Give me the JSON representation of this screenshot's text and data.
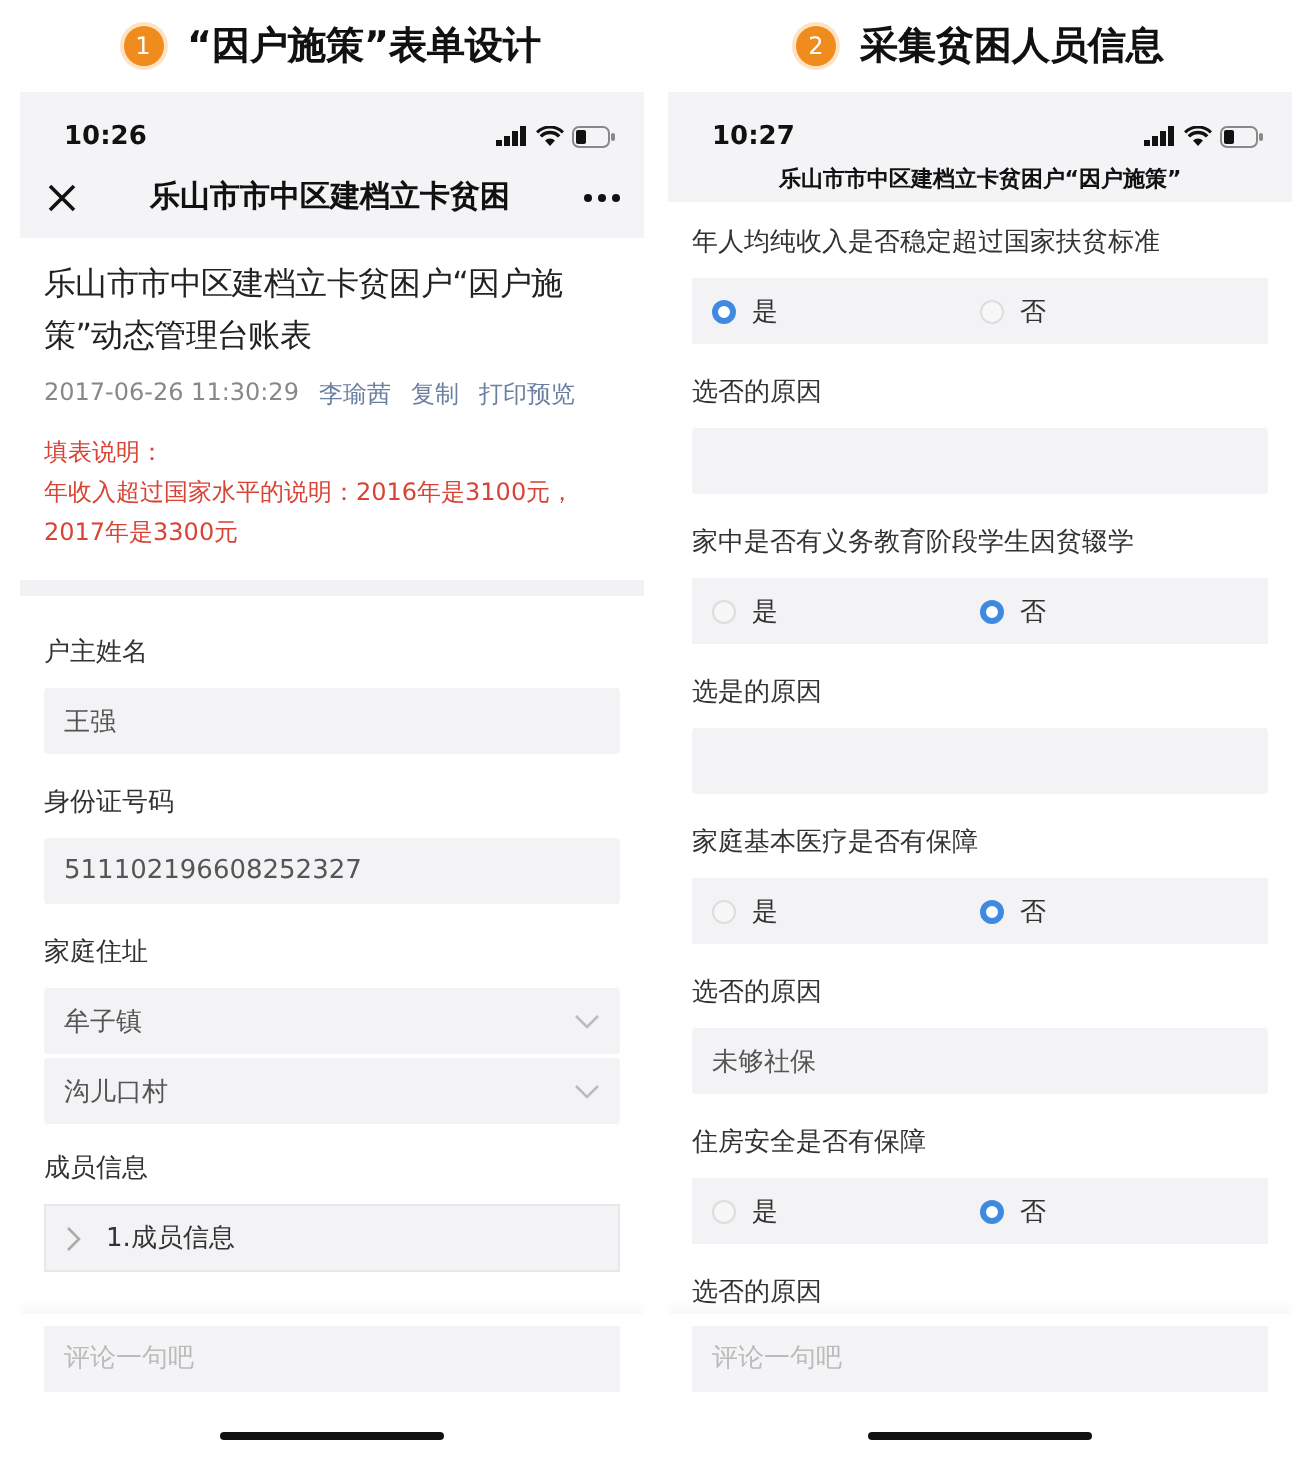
{
  "panels": [
    {
      "badge": "1",
      "title": "“因户施策”表单设计",
      "phone": {
        "time": "10:26",
        "nav": {
          "kind": "full",
          "title": "乐山市市中区建档立卡贫困"
        },
        "document": {
          "title": "乐山市市中区建档立卡贫困户“因户施策”动态管理台账表",
          "date": "2017-06-26 11:30:29",
          "author": "李瑜茜",
          "links": [
            "复制",
            "打印预览"
          ],
          "note": [
            "填表说明：",
            "年收入超过国家水平的说明：2016年是3100元，2017年是3300元"
          ]
        },
        "fields": [
          {
            "kind": "text",
            "label": "户主姓名",
            "value": "王强"
          },
          {
            "kind": "text",
            "label": "身份证号码",
            "value": "511102196608252327"
          },
          {
            "kind": "select",
            "label": "家庭住址",
            "values": [
              "牟子镇",
              "沟儿口村"
            ]
          },
          {
            "kind": "group",
            "label": "成员信息",
            "items": [
              "1.成员信息"
            ]
          }
        ],
        "comment_placeholder": "评论一句吧"
      }
    },
    {
      "badge": "2",
      "title": "采集贫困人员信息",
      "phone": {
        "time": "10:27",
        "nav": {
          "kind": "compact",
          "title": "乐山市市中区建档立卡贫困户“因户施策”"
        },
        "fields": [
          {
            "kind": "radio",
            "label": "年人均纯收入是否稳定超过国家扶贫标准",
            "options": [
              {
                "label": "是",
                "selected": true
              },
              {
                "label": "否",
                "selected": false
              }
            ]
          },
          {
            "kind": "text",
            "label": "选否的原因"
          },
          {
            "kind": "radio",
            "label": "家中是否有义务教育阶段学生因贫辍学",
            "options": [
              {
                "label": "是",
                "selected": false
              },
              {
                "label": "否",
                "selected": true
              }
            ]
          },
          {
            "kind": "text",
            "label": "选是的原因"
          },
          {
            "kind": "radio",
            "label": "家庭基本医疗是否有保障",
            "options": [
              {
                "label": "是",
                "selected": false
              },
              {
                "label": "否",
                "selected": true
              }
            ]
          },
          {
            "kind": "text",
            "label": "选否的原因",
            "value": "未够社保"
          },
          {
            "kind": "radio",
            "label": "住房安全是否有保障",
            "options": [
              {
                "label": "是",
                "selected": false
              },
              {
                "label": "否",
                "selected": true
              }
            ]
          },
          {
            "kind": "label",
            "label": "选否的原因"
          }
        ],
        "comment_placeholder": "评论一句吧"
      }
    }
  ]
}
